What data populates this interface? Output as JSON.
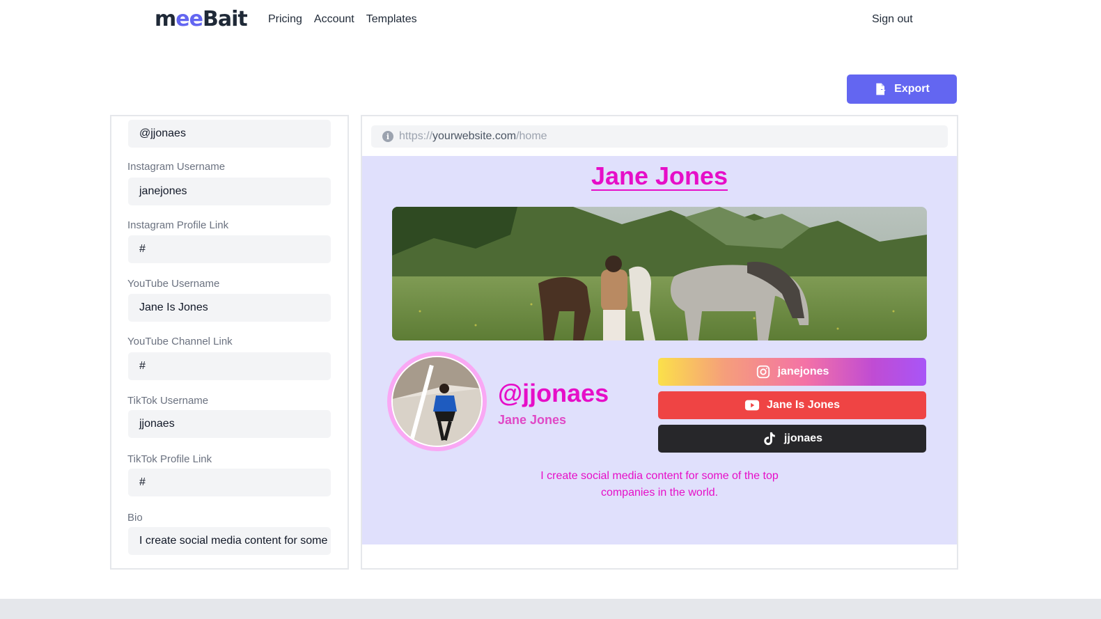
{
  "header": {
    "logo_part1": "m",
    "logo_part2": "ee",
    "logo_part3": "Bait",
    "nav": [
      "Pricing",
      "Account",
      "Templates"
    ],
    "sign_out": "Sign out"
  },
  "toolbar": {
    "export_label": "Export"
  },
  "form": {
    "top_value": "@jjonaes",
    "fields": [
      {
        "label": "Instagram Username",
        "value": "janejones"
      },
      {
        "label": "Instagram Profile Link",
        "value": "#"
      },
      {
        "label": "YouTube Username",
        "value": "Jane Is Jones"
      },
      {
        "label": "YouTube Channel Link",
        "value": "#"
      },
      {
        "label": "TikTok Username",
        "value": "jjonaes"
      },
      {
        "label": "TikTok Profile Link",
        "value": "#"
      },
      {
        "label": "Bio",
        "value": "I create social media content for some of the top companies in the world."
      }
    ]
  },
  "preview": {
    "url": {
      "protocol": "https://",
      "host": "yourwebsite.com",
      "path": "/home"
    },
    "title": "Jane Jones",
    "handle": "@jjonaes",
    "name": "Jane Jones",
    "instagram": "janejones",
    "youtube": "Jane Is Jones",
    "tiktok": "jjonaes",
    "bio": "I create social media content for some of the top companies in the world."
  },
  "colors": {
    "accent": "#6366f1",
    "preview_bg": "#e0e0fc",
    "pink": "#e60ec8",
    "youtube": "#ef4444",
    "tiktok": "#27272a"
  }
}
